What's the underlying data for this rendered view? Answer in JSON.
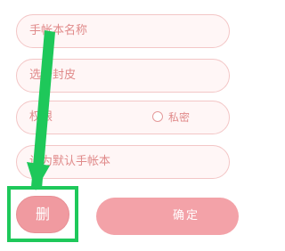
{
  "form": {
    "name_placeholder": "手帐本名称",
    "cover_label": "选个封皮",
    "permission_label": "权限",
    "private_option": "私密",
    "default_label": "设为默认手帐本"
  },
  "actions": {
    "delete_label": "删",
    "confirm_label": "确定"
  },
  "colors": {
    "field_border": "#f3c6c6",
    "field_text": "#e08a8a",
    "button_pink": "#f3a2a8",
    "annotation_green": "#1ec85a"
  },
  "icons": {
    "arrow": "annotation-arrow-icon",
    "radio": "radio-unchecked-icon"
  }
}
